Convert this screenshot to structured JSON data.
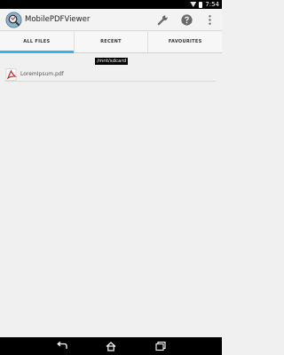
{
  "status_bar": {
    "time": "7:54"
  },
  "action_bar": {
    "title": "MobilePDFViewer",
    "actions": [
      "wrench-icon",
      "help-icon",
      "overflow-menu-icon"
    ]
  },
  "tabs": [
    {
      "label": "ALL FILES",
      "active": true
    },
    {
      "label": "RECENT",
      "active": false
    },
    {
      "label": "FAVOURITES",
      "active": false
    }
  ],
  "current_path": "/mnt/sdcard",
  "files": [
    {
      "name": "LoremIpsum.pdf",
      "icon": "pdf-icon"
    }
  ],
  "nav_bar": {
    "buttons": [
      "back-icon",
      "home-icon",
      "recents-icon"
    ]
  },
  "colors": {
    "accent": "#33b5e5",
    "pdf_red": "#c62828",
    "background": "#f0f0f0"
  }
}
